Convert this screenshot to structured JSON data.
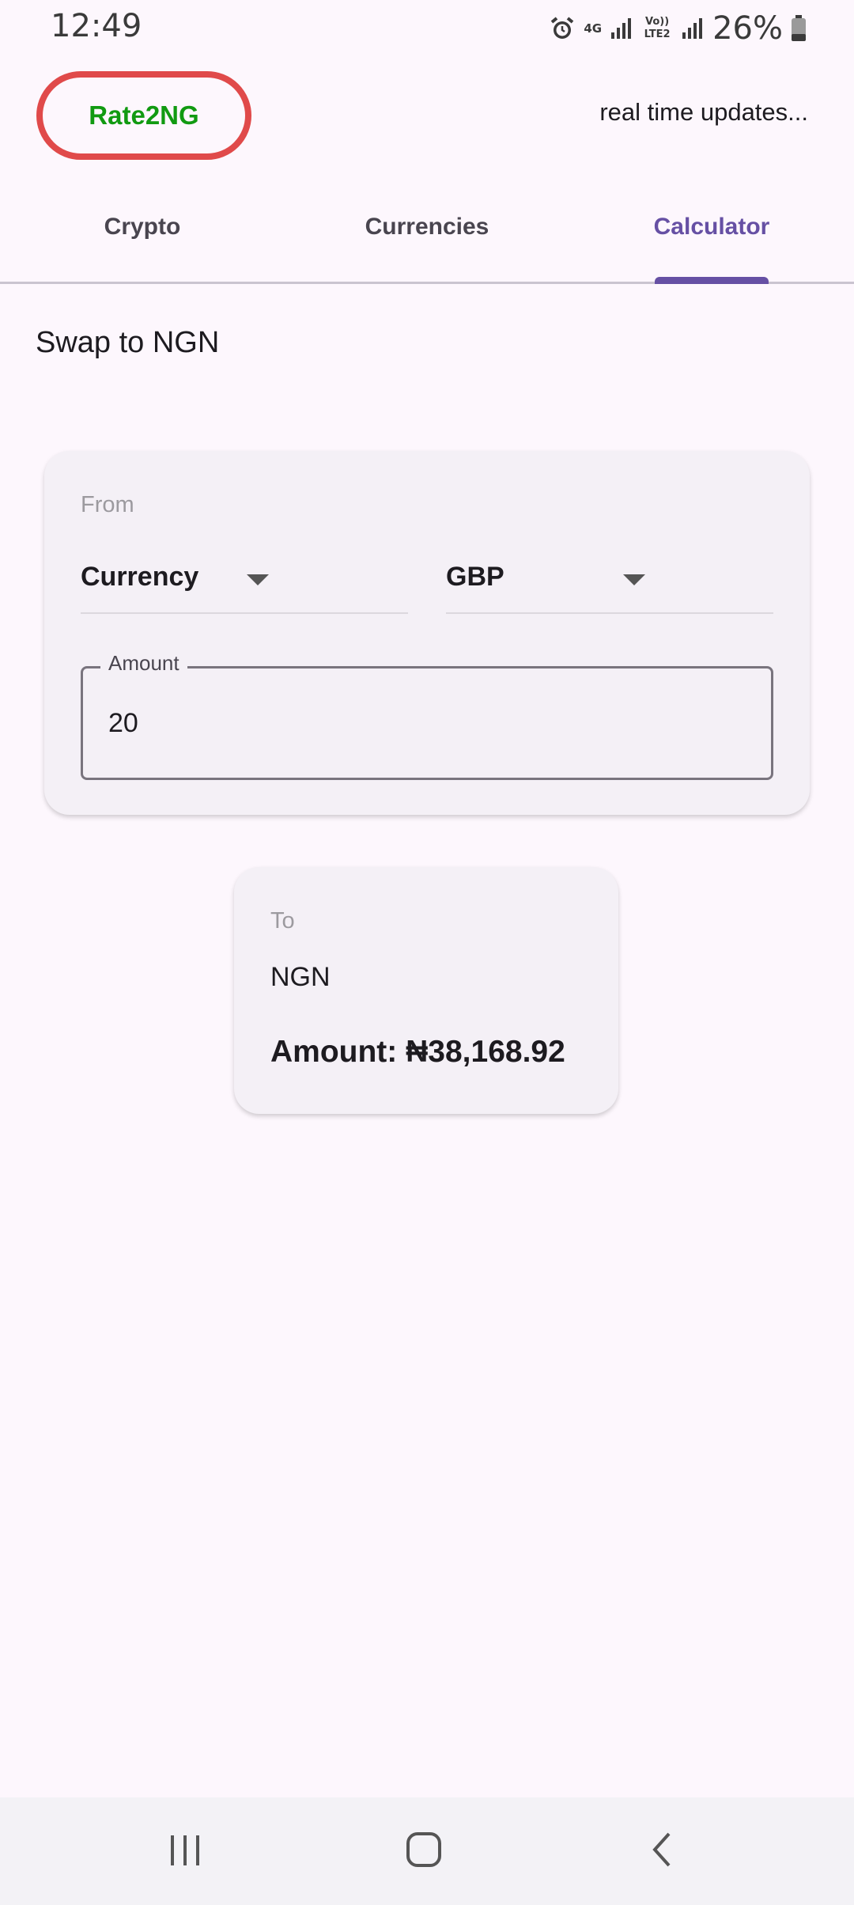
{
  "status_bar": {
    "time": "12:49",
    "network_label": "4G",
    "volte_label": "Vo)) LTE2",
    "battery": "26%"
  },
  "header": {
    "logo": "Rate2NG",
    "updates": "real time updates..."
  },
  "tabs": [
    {
      "label": "Crypto",
      "active": false
    },
    {
      "label": "Currencies",
      "active": false
    },
    {
      "label": "Calculator",
      "active": true
    }
  ],
  "section_title": "Swap to NGN",
  "from_card": {
    "label": "From",
    "type_dropdown": "Currency",
    "currency_dropdown": "GBP",
    "amount_label": "Amount",
    "amount_value": "20"
  },
  "to_card": {
    "label": "To",
    "currency": "NGN",
    "amount_text": "Amount: ₦38,168.92"
  },
  "nav": {
    "recents": "recents-icon",
    "home": "home-icon",
    "back": "back-icon"
  },
  "colors": {
    "accent": "#6650a4",
    "logo_border": "#e04a4a",
    "logo_text": "#119a11",
    "background": "#fdf7fd"
  }
}
